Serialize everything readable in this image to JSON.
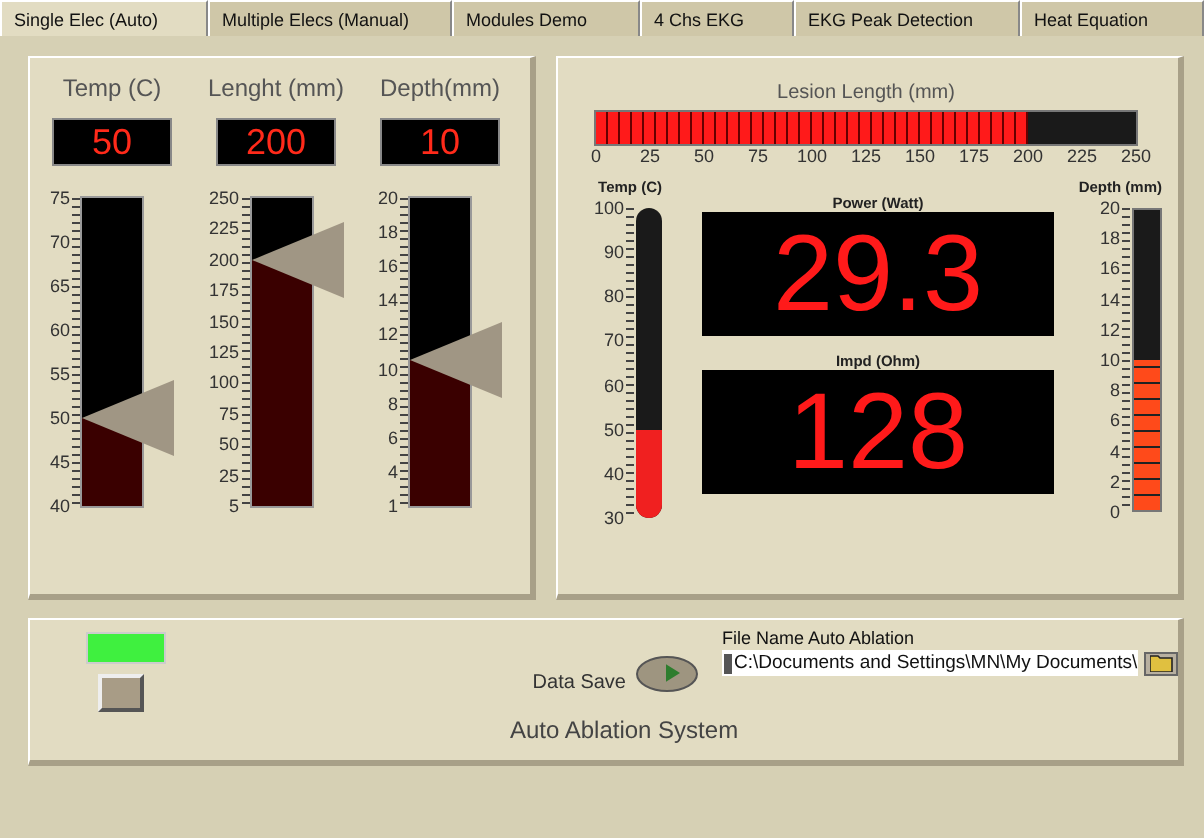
{
  "tabs": [
    {
      "label": "Single Elec (Auto)",
      "selected": true
    },
    {
      "label": "Multiple Elecs (Manual)",
      "selected": false
    },
    {
      "label": "Modules Demo",
      "selected": false
    },
    {
      "label": "4 Chs EKG",
      "selected": false
    },
    {
      "label": "EKG Peak Detection",
      "selected": false
    },
    {
      "label": "Heat Equation",
      "selected": false
    }
  ],
  "sliders": [
    {
      "label": "Temp (C)",
      "value": "50",
      "level": 0.286,
      "ticks": [
        "75",
        "70",
        "65",
        "60",
        "55",
        "50",
        "45",
        "40"
      ]
    },
    {
      "label": "Lenght (mm)",
      "value": "200",
      "level": 0.796,
      "ticks": [
        "250",
        "225",
        "200",
        "175",
        "150",
        "125",
        "100",
        "75",
        "50",
        "25",
        "5"
      ]
    },
    {
      "label": "Depth(mm)",
      "value": "10",
      "level": 0.475,
      "ticks": [
        "20",
        "18",
        "16",
        "14",
        "12",
        "10",
        "8",
        "6",
        "4",
        "1"
      ]
    }
  ],
  "lesion": {
    "label": "Lesion Length (mm)",
    "level": 0.8,
    "ticks": [
      "0",
      "25",
      "50",
      "75",
      "100",
      "125",
      "150",
      "175",
      "200",
      "225",
      "250"
    ]
  },
  "thermometer": {
    "label": "Temp (C)",
    "level": 0.286,
    "ticks": [
      "100",
      "90",
      "80",
      "70",
      "60",
      "50",
      "40",
      "30"
    ]
  },
  "displays": [
    {
      "label": "Power (Watt)",
      "value": "29.3"
    },
    {
      "label": "Impd (Ohm)",
      "value": "128"
    }
  ],
  "depth_meter": {
    "label": "Depth (mm)",
    "level": 0.5,
    "ticks": [
      "20",
      "18",
      "16",
      "14",
      "12",
      "10",
      "8",
      "6",
      "4",
      "2",
      "0"
    ]
  },
  "indicator": {
    "on": true
  },
  "data_save": {
    "label": "Data Save"
  },
  "file_path": {
    "label": "File Name Auto Ablation",
    "value": "C:\\Documents and Settings\\MN\\My Documents\\"
  },
  "footer": {
    "title": "Auto Ablation System"
  }
}
